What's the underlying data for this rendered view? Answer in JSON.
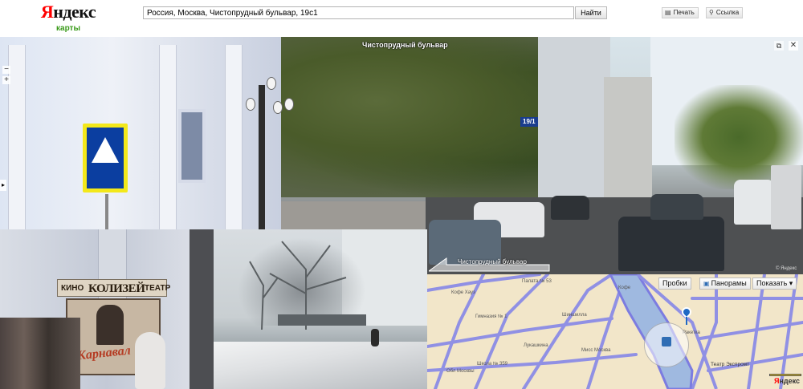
{
  "header": {
    "logo_text_first": "Я",
    "logo_text_rest": "ндекс",
    "logo_sub": "карты",
    "search_value": "Россия, Москва, Чистопрудный бульвар, 19с1",
    "search_button": "Найти",
    "print_label": "Печать",
    "link_label": "Ссылка"
  },
  "panorama": {
    "title": "Чистопрудный бульвар",
    "house_number": "19/1",
    "bottom_street": "Чистопрудный бульвар",
    "copyright": "© Яндекс",
    "zoom_minus": "−",
    "zoom_plus": "+",
    "close_glyph": "✕",
    "expand_glyph": "⧉",
    "left_arrow_glyph": "▸"
  },
  "photo1": {
    "sign_left": "КИНО",
    "sign_mid": "КОЛИЗЕЙ",
    "sign_right": "ТЕАТР",
    "poster_text": "Карнавал"
  },
  "map": {
    "btn_probki": "Пробки",
    "btn_panoramy": "Панорамы",
    "btn_pokazat": "Показать",
    "brand_first": "Я",
    "brand_rest": "ндекс",
    "labels": [
      "Кофе Хауз",
      "Палата № 53",
      "Гимназия № 1",
      "Школа № 359",
      "Театр Экспромт",
      "Обл Москвы",
      "Шиншилла",
      "Мисс Москва",
      "Лукашкина",
      "Ракетка",
      "Кофе"
    ]
  },
  "colors": {
    "logo_red": "#ff0000",
    "logo_sub_green": "#3a9a1a",
    "map_road": "#8f8fe6",
    "map_bg": "#f2e6c9",
    "map_pin": "#1f68c4"
  }
}
